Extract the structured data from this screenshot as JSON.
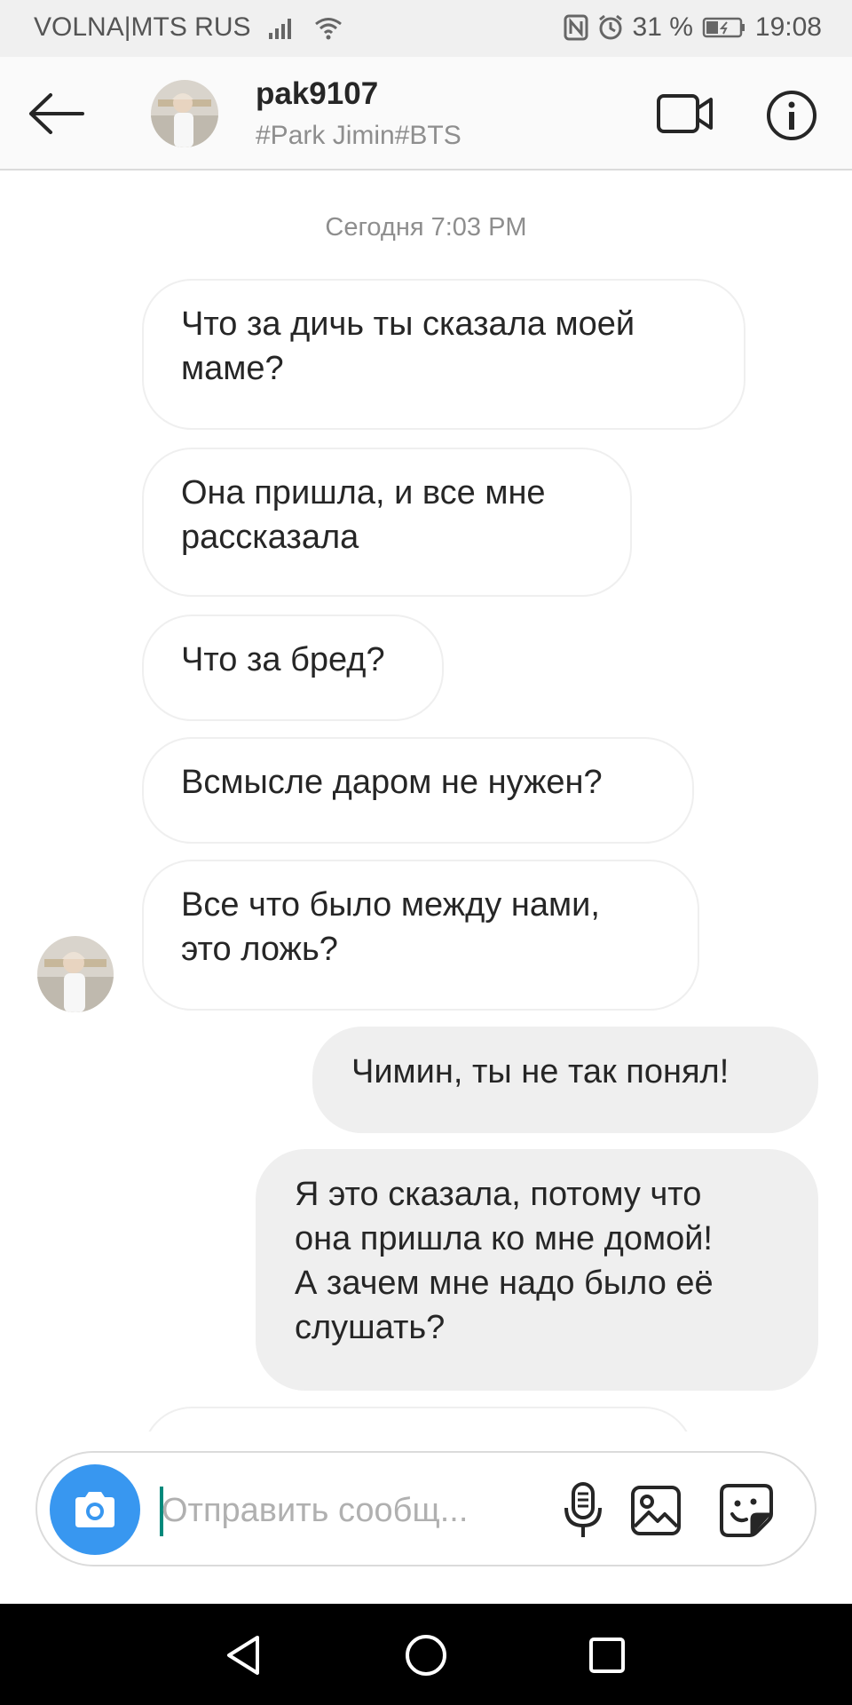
{
  "status_bar": {
    "carrier": "VOLNA|MTS RUS",
    "battery": "31 %",
    "time": "19:08",
    "icons": [
      "signal-icon",
      "wifi-icon",
      "nfc-icon",
      "alarm-icon",
      "battery-icon"
    ]
  },
  "header": {
    "username": "pak9107",
    "subtitle": "#Park Jimin#BTS",
    "icons": [
      "back-arrow-icon",
      "video-call-icon",
      "info-icon"
    ]
  },
  "chat": {
    "timestamp": "Сегодня 7:03 PM",
    "messages": [
      {
        "direction": "incoming",
        "lines": [
          "Что за дичь ты сказала моей",
          "маме?"
        ]
      },
      {
        "direction": "incoming",
        "lines": [
          "Она пришла, и все мне",
          "рассказала"
        ]
      },
      {
        "direction": "incoming",
        "lines": [
          "Что за бред?"
        ]
      },
      {
        "direction": "incoming",
        "lines": [
          "Всмысле даром не нужен?"
        ]
      },
      {
        "direction": "incoming",
        "lines": [
          "Все что было между нами,",
          "это ложь?"
        ]
      },
      {
        "direction": "outgoing",
        "lines": [
          "Чимин, ты не так понял!"
        ]
      },
      {
        "direction": "outgoing",
        "lines": [
          "Я это сказала, потому что",
          "она пришла ко мне домой!",
          "А зачем мне надо было её",
          "слушать?"
        ]
      }
    ]
  },
  "composer": {
    "placeholder": "Отправить сообщ...",
    "value": "",
    "icons": [
      "camera-icon",
      "microphone-icon",
      "gallery-icon",
      "sticker-icon"
    ]
  },
  "nav_bar": {
    "icons": [
      "back-triangle-icon",
      "home-circle-icon",
      "recents-square-icon"
    ]
  },
  "colors": {
    "accent": "#3897f0",
    "outgoing_bubble": "#efefef",
    "incoming_border": "#efefef",
    "nav_background": "#000000"
  }
}
